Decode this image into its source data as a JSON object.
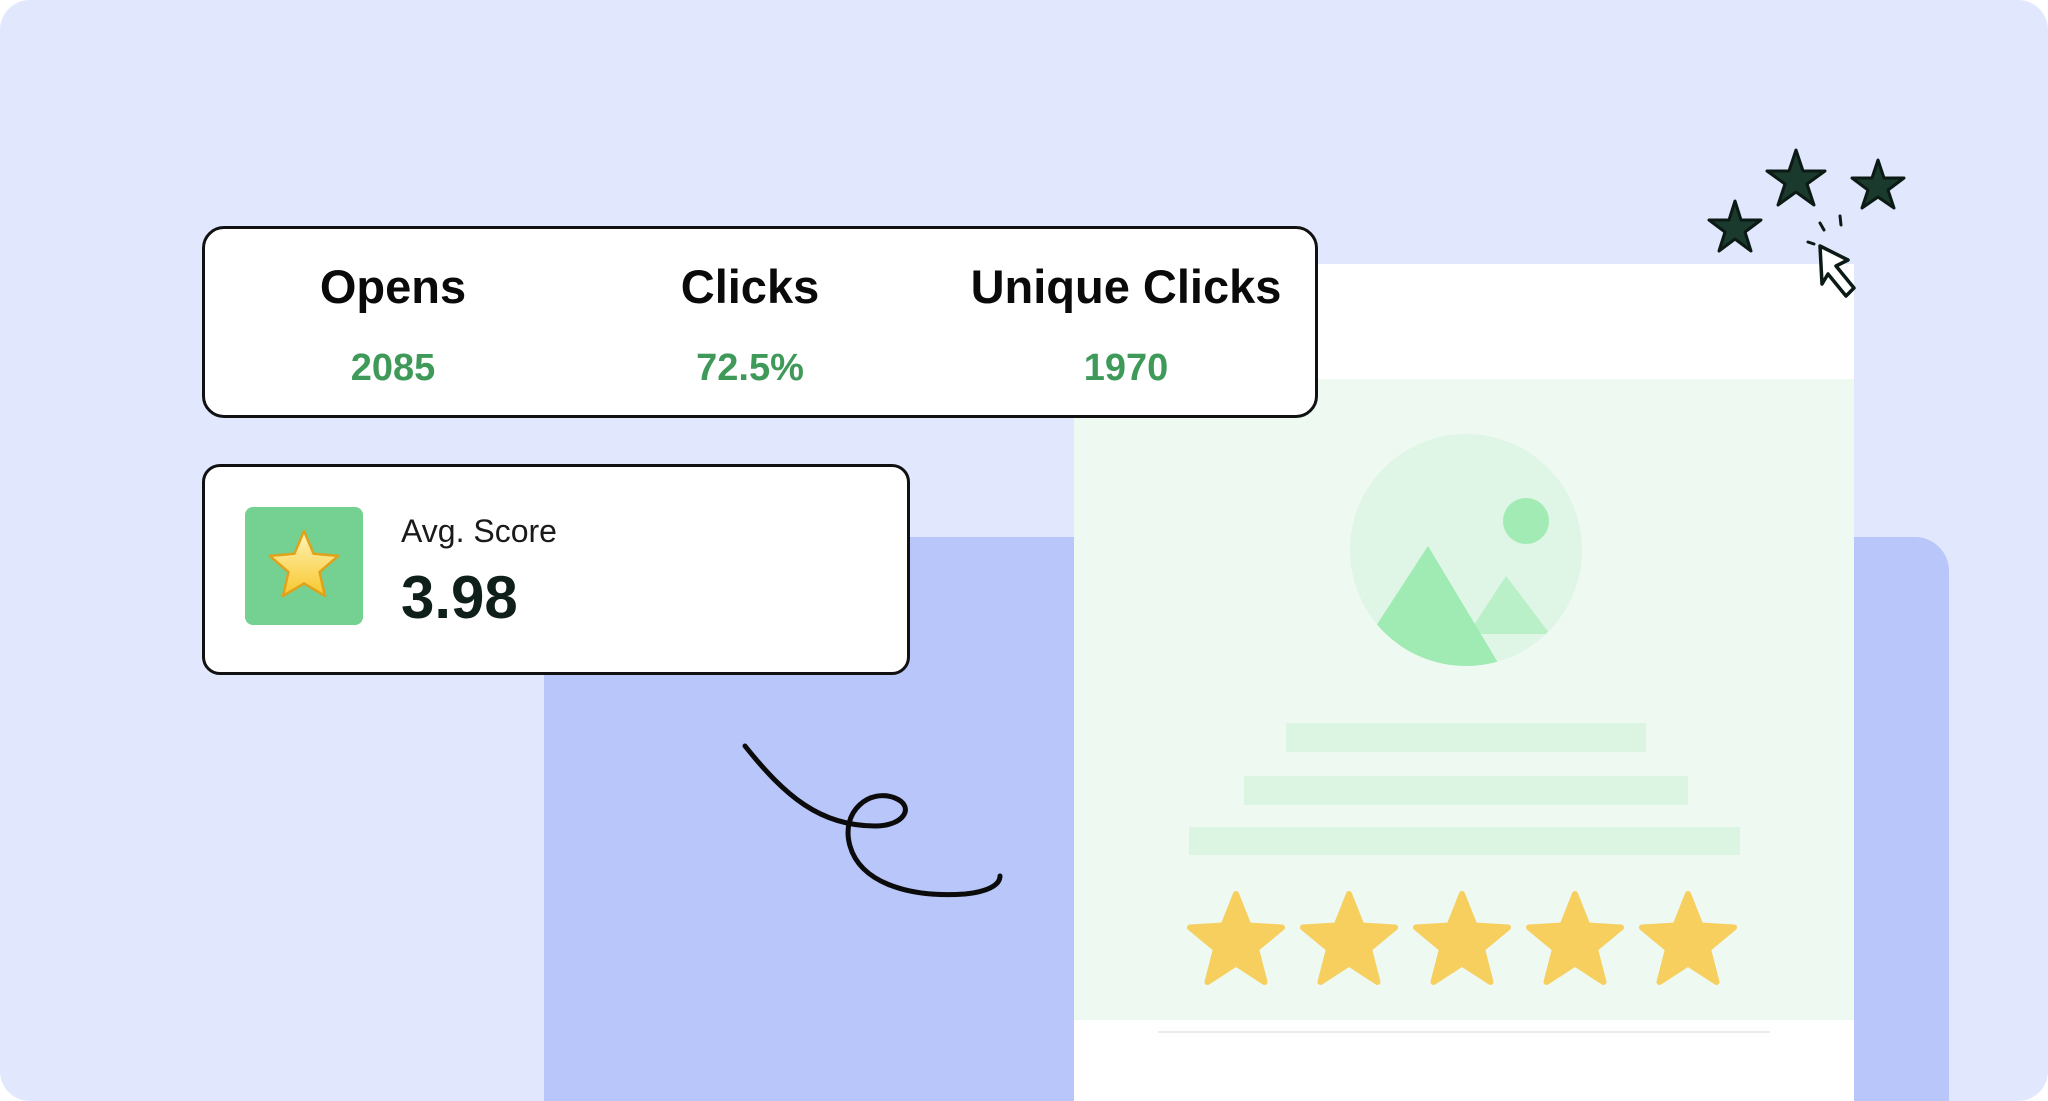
{
  "stats": [
    {
      "label": "Opens",
      "value": "2085"
    },
    {
      "label": "Clicks",
      "value": "72.5%"
    },
    {
      "label": "Unique Clicks",
      "value": "1970"
    }
  ],
  "score": {
    "label": "Avg. Score",
    "value": "3.98"
  },
  "email_preview": {
    "rating_stars": 5,
    "rating_star_color": "#f6cf5e"
  },
  "colors": {
    "background": "#e1e7fd",
    "back_panel": "#b8c6f9",
    "stat_value": "#3f9a5a",
    "score_tile": "#74d191",
    "hero_tint": "#eef9f1"
  },
  "icons": {
    "image_placeholder": "image-icon",
    "score_badge": "star-icon",
    "cursor": "cursor-icon",
    "sparkles": "sparkle-stars-icon"
  }
}
